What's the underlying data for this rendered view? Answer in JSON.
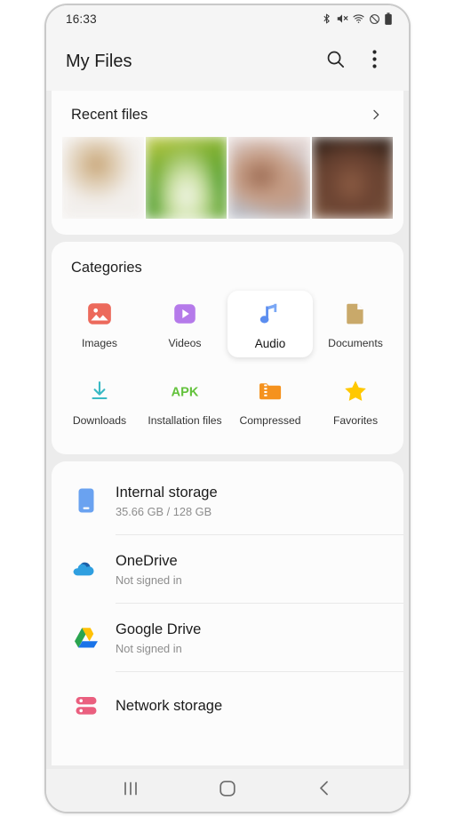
{
  "status_bar": {
    "clock": "16:33",
    "icons": [
      "bluetooth-icon",
      "mute-icon",
      "wifi-icon",
      "do-not-disturb-icon",
      "battery-icon"
    ]
  },
  "app_bar": {
    "title": "My Files",
    "search_icon": "search-icon",
    "menu_icon": "overflow-menu-icon"
  },
  "recent": {
    "title": "Recent files",
    "chevron_icon": "chevron-right-icon",
    "thumbnails": [
      {
        "name": "thumbnail-1",
        "colors": [
          "#f4f1ee",
          "#d8c4ac",
          "#c9c9c9"
        ]
      },
      {
        "name": "thumbnail-2",
        "colors": [
          "#8fb43a",
          "#4f9e2a",
          "#e9f0d8"
        ]
      },
      {
        "name": "thumbnail-3",
        "colors": [
          "#cfc9c9",
          "#a98070",
          "#b9bcc4"
        ]
      },
      {
        "name": "thumbnail-4",
        "colors": [
          "#3c2a22",
          "#8d5d44",
          "#6a4a38"
        ]
      }
    ]
  },
  "categories": {
    "title": "Categories",
    "row1": [
      {
        "label": "Images",
        "icon": "images-icon",
        "color": "#ec6a5c",
        "selected": false
      },
      {
        "label": "Videos",
        "icon": "videos-icon",
        "color": "#b57aea",
        "selected": false
      },
      {
        "label": "Audio",
        "icon": "audio-icon",
        "color": "#5b8def",
        "selected": true
      },
      {
        "label": "Documents",
        "icon": "documents-icon",
        "color": "#c9a96a",
        "selected": false
      }
    ],
    "row2": [
      {
        "label": "Downloads",
        "icon": "downloads-icon",
        "color": "#39b9c4",
        "selected": false
      },
      {
        "label": "Installation files",
        "icon": "apk-icon",
        "color": "#63c23c",
        "selected": false
      },
      {
        "label": "Compressed",
        "icon": "compressed-icon",
        "color": "#f5921e",
        "selected": false
      },
      {
        "label": "Favorites",
        "icon": "favorites-icon",
        "color": "#ffc800",
        "selected": false
      }
    ]
  },
  "storage": [
    {
      "name": "Internal storage",
      "sub": "35.66 GB / 128 GB",
      "icon": "phone-storage-icon"
    },
    {
      "name": "OneDrive",
      "sub": "Not signed in",
      "icon": "onedrive-icon"
    },
    {
      "name": "Google Drive",
      "sub": "Not signed in",
      "icon": "google-drive-icon"
    },
    {
      "name": "Network storage",
      "sub": "",
      "icon": "network-storage-icon"
    }
  ],
  "nav_bar": {
    "recents": "recents-icon",
    "home": "home-icon",
    "back": "back-icon"
  }
}
